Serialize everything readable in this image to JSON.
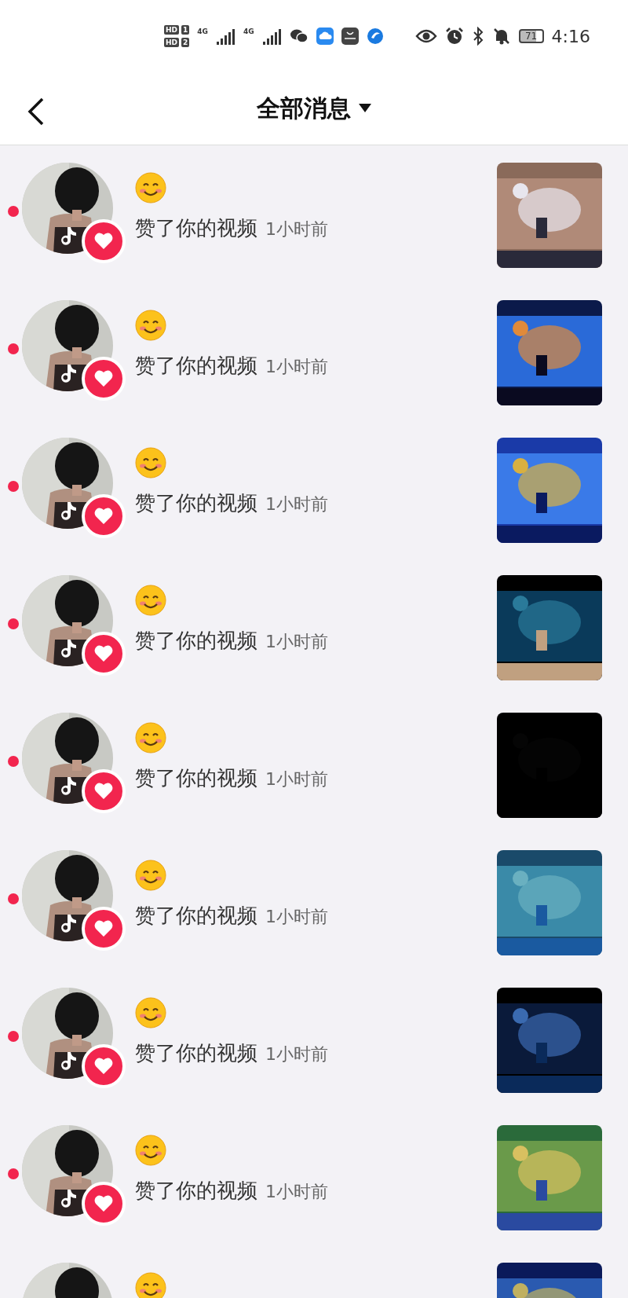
{
  "status_bar": {
    "sims": [
      {
        "badge": "HD",
        "slot": "1"
      },
      {
        "badge": "HD",
        "slot": "2"
      }
    ],
    "networks": [
      "4G",
      "4G"
    ],
    "battery": "71",
    "time": "4:16"
  },
  "header": {
    "title": "全部消息"
  },
  "notifications": [
    {
      "kind": "full",
      "unread": true,
      "action": "赞了你的视频",
      "time": "1小时前"
    },
    {
      "kind": "full",
      "unread": true,
      "action": "赞了你的视频",
      "time": "1小时前"
    },
    {
      "kind": "full",
      "unread": true,
      "action": "赞了你的视频",
      "time": "1小时前"
    },
    {
      "kind": "full",
      "unread": true,
      "action": "赞了你的视频",
      "time": "1小时前"
    },
    {
      "kind": "full",
      "unread": true,
      "action": "赞了你的视频",
      "time": "1小时前"
    },
    {
      "kind": "full",
      "unread": true,
      "action": "赞了你的视频",
      "time": "1小时前"
    },
    {
      "kind": "full",
      "unread": true,
      "action": "赞了你的视频",
      "time": "1小时前"
    },
    {
      "kind": "full",
      "unread": true,
      "action": "赞了你的视频",
      "time": "1小时前"
    },
    {
      "kind": "cut"
    }
  ]
}
